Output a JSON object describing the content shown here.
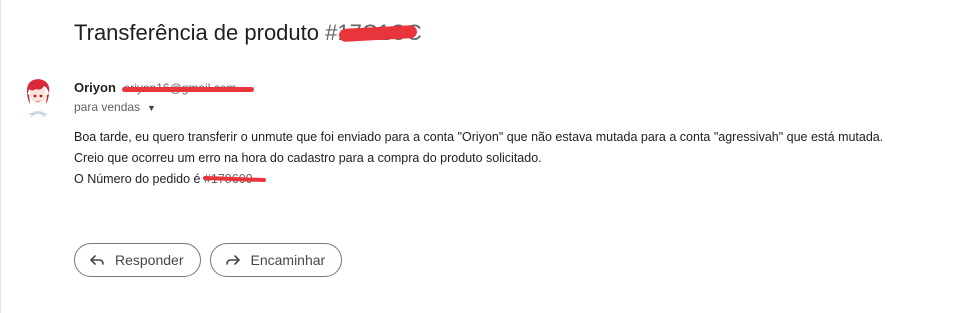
{
  "email": {
    "subject": "Transferência de produto",
    "subject_suffix_redacted": "#17C1CC",
    "sender": {
      "name": "Oriyon",
      "email_redacted": "oriyon16@gmail.com"
    },
    "recipient": {
      "label": "para vendas"
    },
    "body": {
      "line1": "Boa tarde, eu quero transferir o unmute que foi enviado para a conta \"Oriyon\" que não estava mutada para a conta \"agressivah\" que está mutada.",
      "line2": "Creio que ocorreu um erro na hora do cadastro para a compra do produto solicitado.",
      "line3_prefix": "O Número do pedido é",
      "order_number_redacted": "#178600"
    }
  },
  "actions": {
    "reply_label": "Responder",
    "forward_label": "Encaminhar"
  },
  "icons": {
    "reply": "reply-icon",
    "forward": "forward-icon",
    "recipient_dropdown": "chevron-down-icon"
  },
  "colors": {
    "redaction": "#e8343b",
    "button_border": "#747775"
  }
}
